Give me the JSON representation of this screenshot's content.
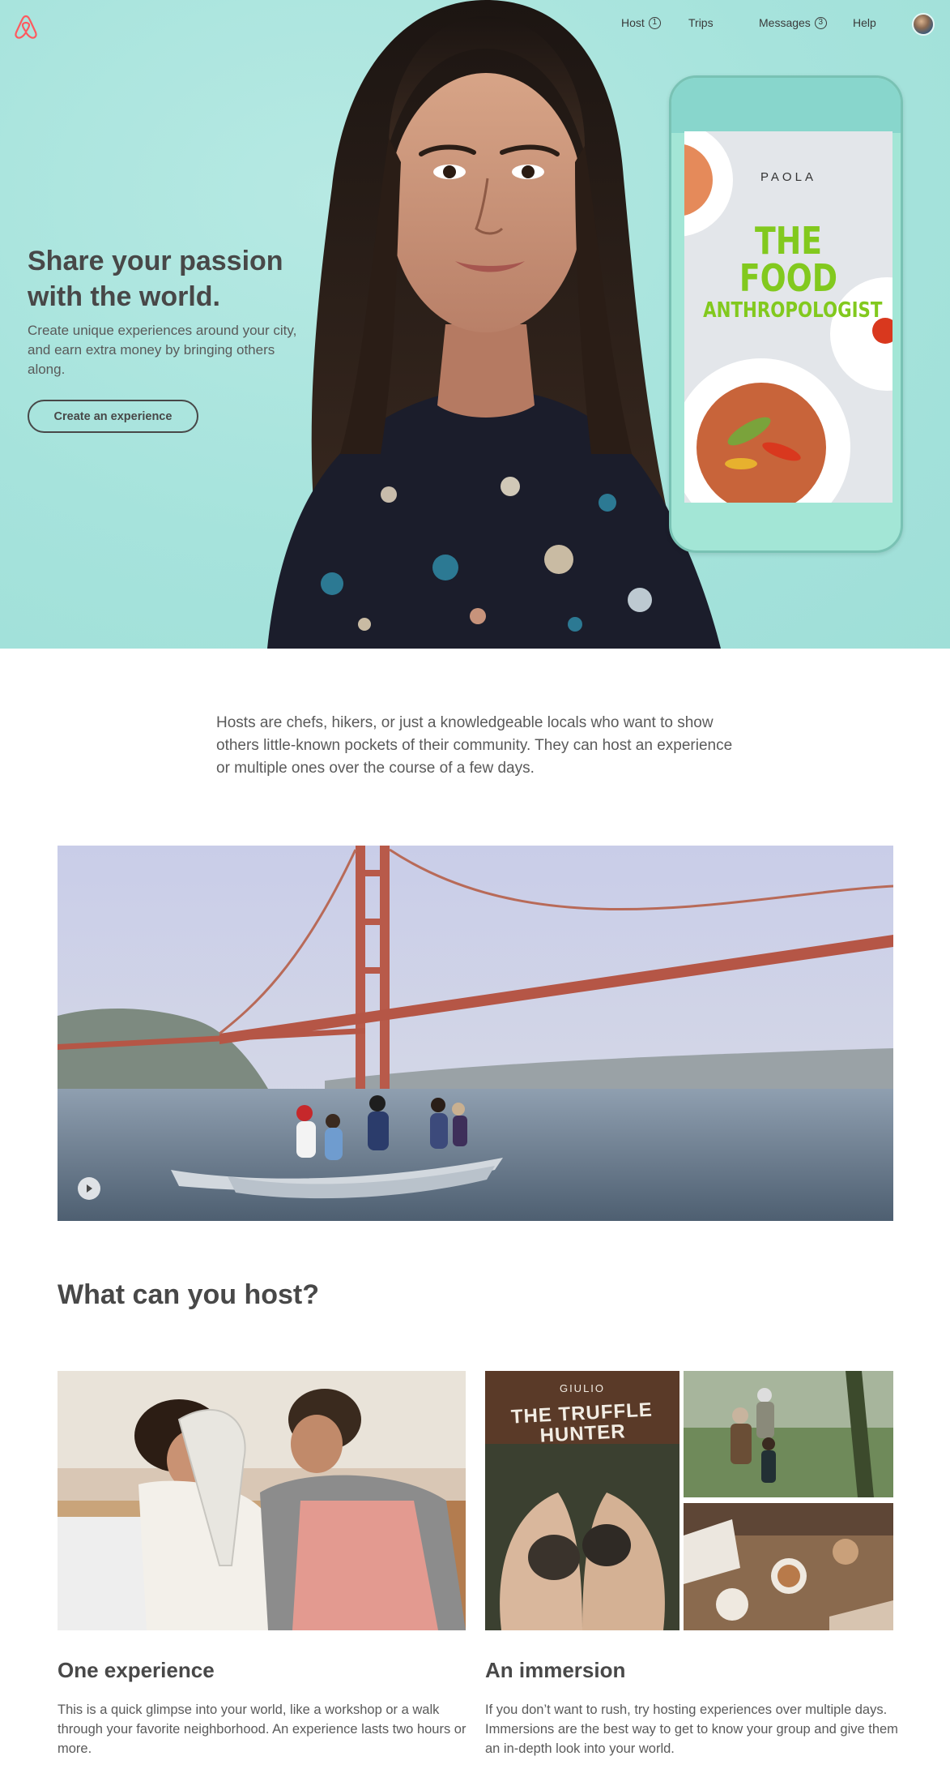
{
  "nav": {
    "items": [
      {
        "label": "Host",
        "count": "1"
      },
      {
        "label": "Trips"
      },
      {
        "label": "Messages",
        "count": "3"
      },
      {
        "label": "Help"
      }
    ]
  },
  "hero": {
    "title_line1": "Share your passion",
    "title_line2": "with the world.",
    "subtitle": "Create unique experiences around your city, and earn extra money by bringing others along.",
    "cta_label": "Create an experience",
    "phone": {
      "host_name": "PAOLA",
      "experience_title_line1": "THE FOOD",
      "experience_title_line2": "ANTHROPOLOGIST"
    }
  },
  "intro": {
    "text": "Hosts are chefs, hikers, or just a knowledgeable locals who want to show others little-known pockets of their community. They can host an experience or multiple ones over the course of a few days."
  },
  "section": {
    "title": "What can you host?"
  },
  "cards": [
    {
      "title": "One experience",
      "description": "This is a quick glimpse into your world, like a workshop or a walk through your favorite neighborhood. An experience lasts two hours or more."
    },
    {
      "title": "An immersion",
      "description": "If you don’t want to rush, try hosting experiences over multiple days. Immersions are the best way to get to know your group and give them an in-depth look into your world.",
      "featured_host": "GIULIO",
      "featured_title_line1": "THE TRUFFLE",
      "featured_title_line2": "HUNTER"
    }
  ],
  "colors": {
    "brand": "#FF5A5F",
    "hero_background": "#A6E3DC",
    "text_dark": "#484848",
    "accent_green": "#82C91E"
  }
}
